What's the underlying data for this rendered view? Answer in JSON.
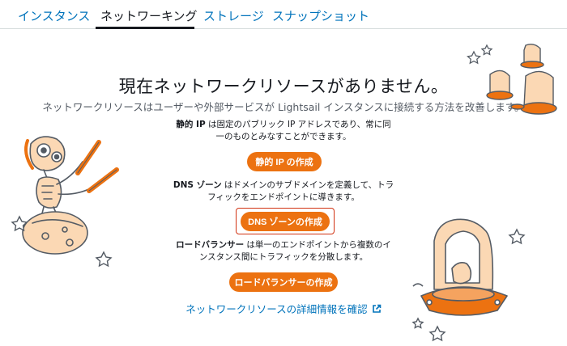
{
  "tabs": [
    {
      "label": "インスタンス",
      "active": false
    },
    {
      "label": "ネットワーキング",
      "active": true
    },
    {
      "label": "ストレージ",
      "active": false
    },
    {
      "label": "スナップショット",
      "active": false
    }
  ],
  "empty_state": {
    "title": "現在ネットワークリソースがありません。",
    "subtitle": "ネットワークリソースはユーザーや外部サービスが Lightsail インスタンスに接続する方法を改善します。"
  },
  "static_ip": {
    "term": "静的 IP",
    "description_line1": " は固定のパブリック IP アドレスであり、常に同",
    "description_line2": "一のものとみなすことができます。",
    "button_label": "静的 IP の作成"
  },
  "dns_zone": {
    "term": "DNS ゾーン",
    "description_line1": " はドメインのサブドメインを定義して、トラ",
    "description_line2": "フィックをエンドポイントに導きます。",
    "button_label": "DNS ゾーンの作成"
  },
  "load_balancer": {
    "term": "ロードバランサー",
    "description_line1": " は単一のエンドポイントから複数のイ",
    "description_line2": "ンスタンス間にトラフィックを分散します。",
    "button_label": "ロードバランサーの作成"
  },
  "learn_more_link": "ネットワークリソースの詳細情報を確認",
  "colors": {
    "accent": "#ec7211",
    "link": "#0073bb",
    "highlight": "#d13212"
  }
}
